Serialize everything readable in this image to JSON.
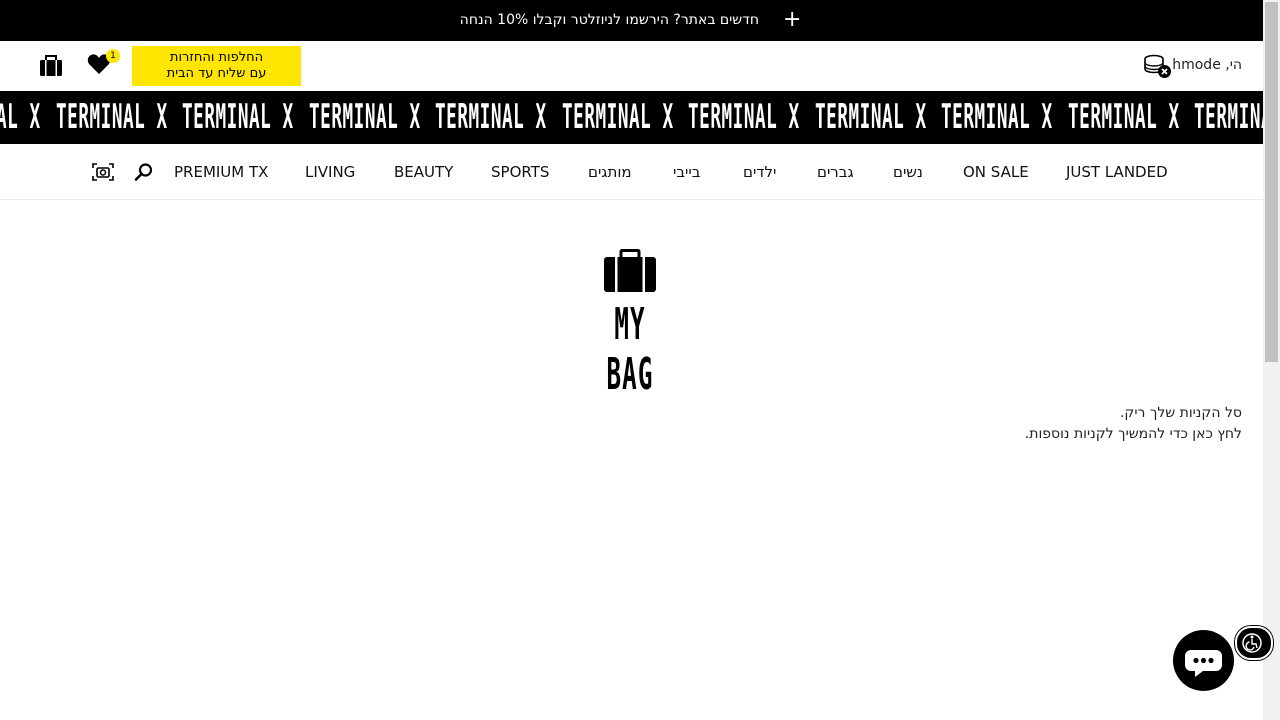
{
  "promo": {
    "text": "חדשים באתר? הירשמו לניוזלטר וקבלו 10% הנחה",
    "plus": "+"
  },
  "header": {
    "wishlist_count": "1",
    "shipping_line1": "החלפות והחזרות",
    "shipping_line2": "עם שליח עד הבית",
    "greeting": "הי, hmode"
  },
  "ticker": {
    "brand": "TERMINAL X",
    "repeat": 11
  },
  "nav": {
    "items": [
      "JUST LANDED",
      "ON SALE",
      "נשים",
      "גברים",
      "ילדים",
      "בייבי",
      "מותגים",
      "SPORTS",
      "BEAUTY",
      "LIVING",
      "PREMIUM TX"
    ]
  },
  "cart": {
    "title": "MY BAG",
    "empty_line1": "סל הקניות שלך ריק.",
    "empty_line2": "לחץ כאן כדי להמשיך לקניות נוספות."
  },
  "icons": {
    "promo": "plus-icon",
    "bag": "shopping-bag-icon",
    "heart": "heart-icon",
    "coins": "coins-icon",
    "camera": "camera-search-icon",
    "search": "search-icon",
    "chat": "chat-icon",
    "accessibility": "accessibility-icon"
  },
  "colors": {
    "accent": "#ffe600",
    "dark": "#000000"
  }
}
